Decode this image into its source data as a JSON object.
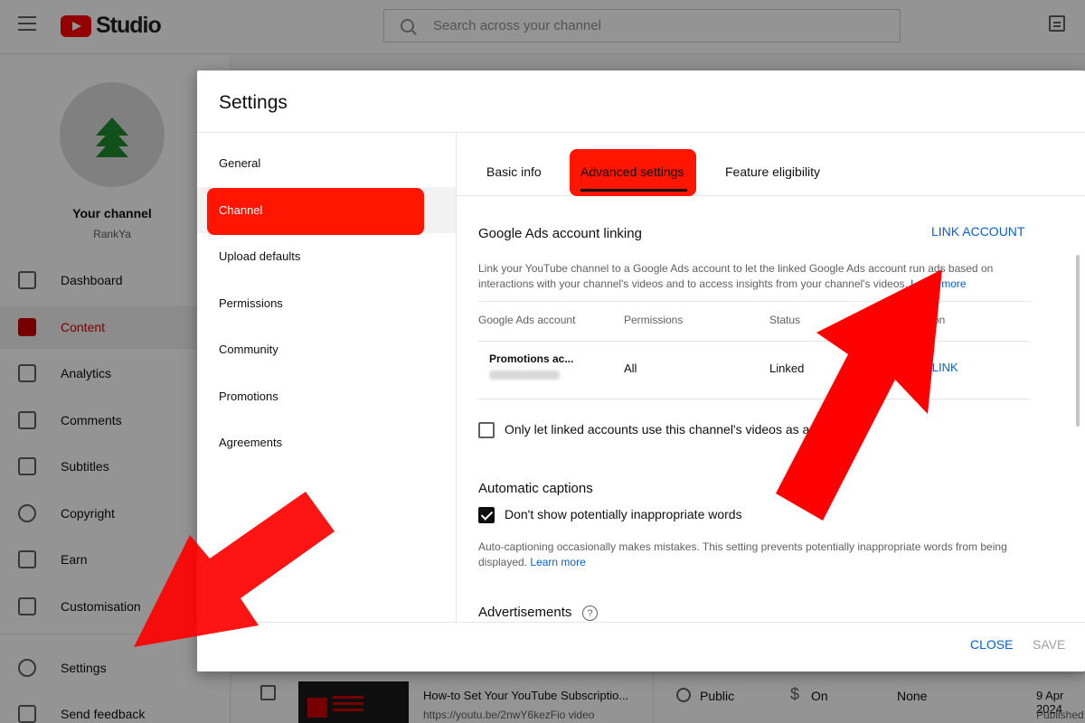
{
  "header": {
    "logo_text": "Studio",
    "search_placeholder": "Search across your channel"
  },
  "sidebar": {
    "channel_name": "Your channel",
    "channel_handle": "RankYa",
    "items": [
      {
        "label": "Dashboard",
        "icon": "dashboard-icon"
      },
      {
        "label": "Content",
        "icon": "content-icon",
        "active": true
      },
      {
        "label": "Analytics",
        "icon": "analytics-icon"
      },
      {
        "label": "Comments",
        "icon": "comments-icon"
      },
      {
        "label": "Subtitles",
        "icon": "subtitles-icon"
      },
      {
        "label": "Copyright",
        "icon": "copyright-icon"
      },
      {
        "label": "Earn",
        "icon": "earn-icon"
      },
      {
        "label": "Customisation",
        "icon": "customisation-icon"
      },
      {
        "label": "Settings",
        "icon": "gear-icon"
      },
      {
        "label": "Send feedback",
        "icon": "feedback-icon"
      }
    ]
  },
  "video_row": {
    "title": "How-to Set Your YouTube Subscriptio...",
    "url": "https://youtu.be/2nwY6kezFio video",
    "visibility": "Public",
    "monetization": "On",
    "restrictions": "None",
    "date": "9 Apr 2024",
    "date_status": "Published"
  },
  "dialog": {
    "title": "Settings",
    "nav": [
      "General",
      "Channel",
      "Upload defaults",
      "Permissions",
      "Community",
      "Promotions",
      "Agreements"
    ],
    "tabs": [
      "Basic info",
      "Advanced settings",
      "Feature eligibility"
    ],
    "ads": {
      "title": "Google Ads account linking",
      "link_button": "LINK ACCOUNT",
      "description": "Link your YouTube channel to a Google Ads account to let the linked Google Ads account run ads based on interactions with your channel's videos and to access insights from your channel's videos.",
      "learn_more": "Learn more",
      "columns": [
        "Google Ads account",
        "Permissions",
        "Status",
        "Action"
      ],
      "row": {
        "account": "Promotions ac...",
        "permissions": "All",
        "status": "Linked",
        "action": "UNLINK"
      },
      "checkbox_label": "Only let linked accounts use this channel's videos as ads",
      "checkbox_checked": false
    },
    "captions": {
      "title": "Automatic captions",
      "checkbox_label": "Don't show potentially inappropriate words",
      "checkbox_checked": true,
      "description": "Auto-captioning occasionally makes mistakes. This setting prevents potentially inappropriate words from being displayed.",
      "learn_more": "Learn more"
    },
    "advertisements": {
      "title": "Advertisements",
      "help_glyph": "?"
    },
    "close_label": "CLOSE",
    "save_label": "SAVE"
  },
  "colors": {
    "highlight": "#ff1500",
    "arrow": "#ff0000",
    "link": "#065fd4"
  }
}
